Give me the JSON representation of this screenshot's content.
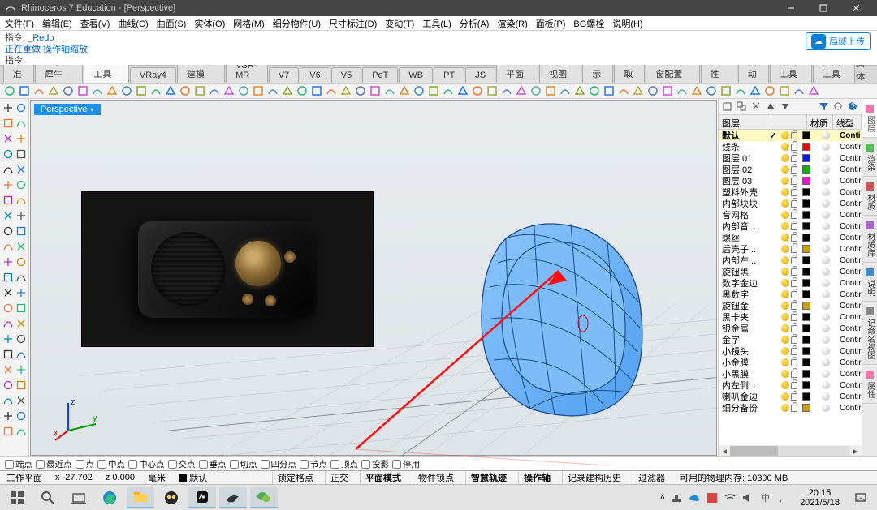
{
  "window": {
    "title": "Rhinoceros 7 Education - [Perspective]"
  },
  "menu": [
    "文件(F)",
    "编辑(E)",
    "查看(V)",
    "曲线(C)",
    "曲面(S)",
    "实体(O)",
    "网格(M)",
    "细分物件(U)",
    "尺寸标注(D)",
    "变动(T)",
    "工具(L)",
    "分析(A)",
    "渲染(R)",
    "面板(P)",
    "BG螺栓",
    "说明(H)"
  ],
  "cloud": {
    "label": "局域上传"
  },
  "cmd": {
    "l1_label": "指令:",
    "l1_val": "_Redo",
    "l2": "正在重做 操作轴缩放",
    "l3_label": "指令:"
  },
  "tabs": {
    "items": [
      "标准",
      "卓尔谦犀牛",
      "SubD工具",
      "VRay4",
      "多边形建模",
      "VSR-MR",
      "V7",
      "V6",
      "V5",
      "PeT",
      "WB",
      "PT",
      "JS",
      "工作平面",
      "设置视图",
      "显示",
      "选取",
      "工作视窗配置",
      "可见性",
      "变动",
      "曲线工具",
      "曲面工具"
    ],
    "active": 2,
    "end": "实体;"
  },
  "viewport": {
    "label": "Perspective"
  },
  "layerHeader": {
    "name": "图层",
    "mat": "材质",
    "lt": "线型"
  },
  "layers": [
    {
      "name": "默认",
      "color": "#000000",
      "lt": "Conti",
      "current": true
    },
    {
      "name": "线条",
      "color": "#ff0000",
      "lt": "Contir"
    },
    {
      "name": "图层 01",
      "color": "#0018ff",
      "lt": "Contir"
    },
    {
      "name": "图层 02",
      "color": "#00b400",
      "lt": "Contir"
    },
    {
      "name": "图层 03",
      "color": "#ff00e6",
      "lt": "Contir"
    },
    {
      "name": "塑料外壳",
      "color": "#000000",
      "lt": "Contir"
    },
    {
      "name": "内部块块",
      "color": "#000000",
      "lt": "Contir"
    },
    {
      "name": "音网格",
      "color": "#000000",
      "lt": "Contir"
    },
    {
      "name": "内部音...",
      "color": "#000000",
      "lt": "Contir"
    },
    {
      "name": "螺丝",
      "color": "#000000",
      "lt": "Contir"
    },
    {
      "name": "后壳子...",
      "color": "#c8a000",
      "lt": "Contir"
    },
    {
      "name": "内部左...",
      "color": "#000000",
      "lt": "Contir"
    },
    {
      "name": "旋钮黑",
      "color": "#000000",
      "lt": "Contir"
    },
    {
      "name": "数字金边",
      "color": "#000000",
      "lt": "Contir"
    },
    {
      "name": "黑数字",
      "color": "#000000",
      "lt": "Contir"
    },
    {
      "name": "旋钮金",
      "color": "#c8a000",
      "lt": "Contir"
    },
    {
      "name": "黑卡夹",
      "color": "#000000",
      "lt": "Contir"
    },
    {
      "name": "银金属",
      "color": "#000000",
      "lt": "Contir"
    },
    {
      "name": "金字",
      "color": "#000000",
      "lt": "Contir"
    },
    {
      "name": "小镜头",
      "color": "#000000",
      "lt": "Contir"
    },
    {
      "name": "小金膜",
      "color": "#000000",
      "lt": "Contir"
    },
    {
      "name": "小黑膜",
      "color": "#000000",
      "lt": "Contir"
    },
    {
      "name": "内左侧...",
      "color": "#000000",
      "lt": "Contir"
    },
    {
      "name": "喇叭金边",
      "color": "#000000",
      "lt": "Contir"
    },
    {
      "name": "细分备份",
      "color": "#c8a000",
      "lt": "Contir"
    }
  ],
  "sideTabs": [
    "图层",
    "渲染",
    "材质",
    "材质库",
    "说明",
    "记命名视图",
    "属性"
  ],
  "osnap": {
    "items": [
      "端点",
      "最近点",
      "点",
      "中点",
      "中心点",
      "交点",
      "垂点",
      "切点",
      "四分点",
      "节点",
      "顶点",
      "投影",
      "停用"
    ],
    "checked": []
  },
  "status": {
    "plane": "工作平面",
    "x": "x -27.702",
    "z": "z 0.000",
    "unit": "毫米",
    "layer": "默认",
    "items": [
      "锁定格点",
      "正交",
      "平面模式",
      "物件锁点",
      "智慧轨迹",
      "操作轴",
      "记录建构历史",
      "过滤器"
    ],
    "bold": [
      2,
      4,
      5
    ],
    "mem": "可用的物理内存: 10390 MB"
  },
  "clock": {
    "time": "20:15",
    "date": "2021/5/18"
  }
}
